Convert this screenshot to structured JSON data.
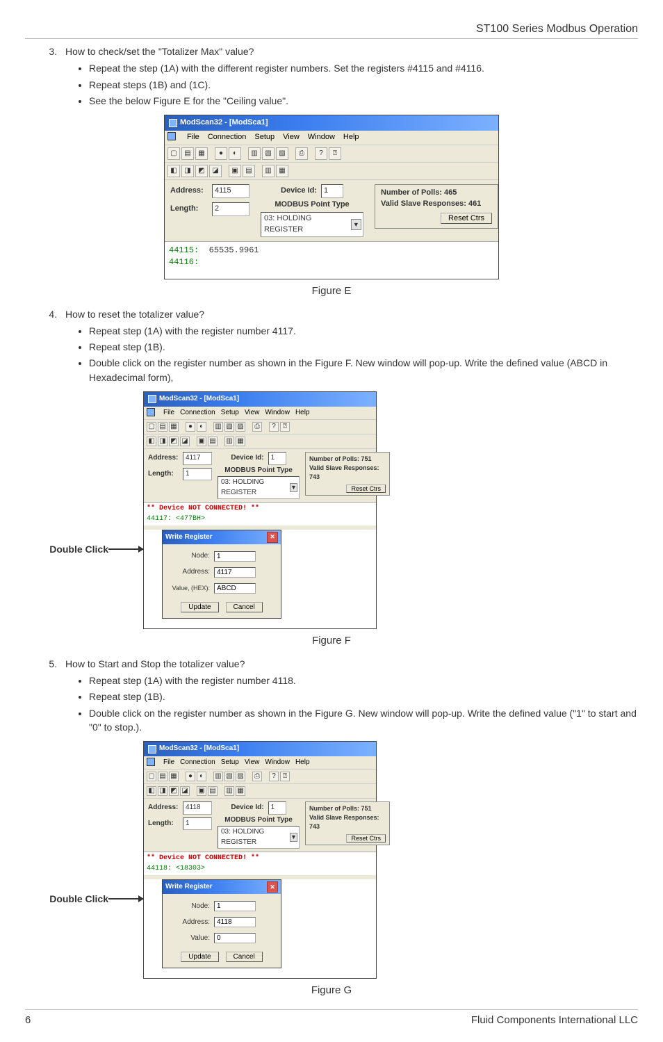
{
  "header": {
    "title": "ST100 Series Modbus Operation"
  },
  "sections": {
    "s3": {
      "num": "3.",
      "heading": "How to check/set the \"Totalizer Max\" value?",
      "bullets": {
        "b1": "Repeat the step (1A) with the different register numbers. Set the registers #4115 and #4116.",
        "b2": "Repeat steps (1B) and (1C).",
        "b3": "See the below Figure E for the \"Ceiling value\"."
      }
    },
    "s4": {
      "num": "4.",
      "heading": "How to reset the totalizer value?",
      "bullets": {
        "b1": "Repeat step (1A) with the register number 4117.",
        "b2": "Repeat step (1B).",
        "b3": "Double click on the register number as shown in the Figure F. New window will pop-up. Write the defined value (ABCD in Hexadecimal form),"
      }
    },
    "s5": {
      "num": "5.",
      "heading": "How to Start and Stop the totalizer value?",
      "bullets": {
        "b1": "Repeat step (1A) with the register number 4118.",
        "b2": "Repeat step (1B).",
        "b3": "Double click on the register number as shown in the Figure G. New window will pop-up. Write the defined value (\"1\" to start and \"0\" to stop.)."
      }
    }
  },
  "figures": {
    "E": {
      "caption": "Figure E",
      "window_title": "ModScan32 - [ModSca1]",
      "menus": {
        "file": "File",
        "connection": "Connection",
        "setup": "Setup",
        "view": "View",
        "window": "Window",
        "help": "Help"
      },
      "labels": {
        "address": "Address:",
        "length": "Length:",
        "device_id": "Device Id:",
        "point_type": "MODBUS Point Type"
      },
      "values": {
        "address": "4115",
        "length": "2",
        "device_id": "1",
        "point_type": "03: HOLDING REGISTER"
      },
      "stats": {
        "polls": "Number of Polls: 465",
        "responses": "Valid Slave Responses: 461",
        "reset": "Reset Ctrs"
      },
      "data": {
        "line1": "44115:",
        "line1_val": "65535.9961",
        "line2": "44116:"
      }
    },
    "F": {
      "caption": "Figure F",
      "side_label": "Double Click",
      "window_title": "ModScan32 - [ModSca1]",
      "menus": {
        "file": "File",
        "connection": "Connection",
        "setup": "Setup",
        "view": "View",
        "window": "Window",
        "help": "Help"
      },
      "labels": {
        "address": "Address:",
        "length": "Length:",
        "device_id": "Device Id:",
        "point_type": "MODBUS Point Type"
      },
      "values": {
        "address": "4117",
        "length": "1",
        "device_id": "1",
        "point_type": "03: HOLDING REGISTER"
      },
      "stats": {
        "polls": "Number of Polls: 751",
        "responses": "Valid Slave Responses: 743",
        "reset": "Reset Ctrs"
      },
      "data": {
        "err": "** Device NOT CONNECTED! **",
        "reg": "44117: <477BH>"
      },
      "dialog": {
        "title": "Write Register",
        "node_lbl": "Node:",
        "node_val": "1",
        "addr_lbl": "Address:",
        "addr_val": "4117",
        "val_lbl": "Value, (HEX):",
        "val_val": "ABCD",
        "update": "Update",
        "cancel": "Cancel"
      }
    },
    "G": {
      "caption": "Figure G",
      "side_label": "Double Click",
      "window_title": "ModScan32 - [ModSca1]",
      "menus": {
        "file": "File",
        "connection": "Connection",
        "setup": "Setup",
        "view": "View",
        "window": "Window",
        "help": "Help"
      },
      "labels": {
        "address": "Address:",
        "length": "Length:",
        "device_id": "Device Id:",
        "point_type": "MODBUS Point Type"
      },
      "values": {
        "address": "4118",
        "length": "1",
        "device_id": "1",
        "point_type": "03: HOLDING REGISTER"
      },
      "stats": {
        "polls": "Number of Polls: 751",
        "responses": "Valid Slave Responses: 743",
        "reset": "Reset Ctrs"
      },
      "data": {
        "err": "** Device NOT CONNECTED! **",
        "reg": "44118: <18303>"
      },
      "dialog": {
        "title": "Write Register",
        "node_lbl": "Node:",
        "node_val": "1",
        "addr_lbl": "Address:",
        "addr_val": "4118",
        "val_lbl": "Value:",
        "val_val": "0",
        "update": "Update",
        "cancel": "Cancel"
      }
    }
  },
  "footer": {
    "page": "6",
    "company": "Fluid Components International LLC"
  }
}
